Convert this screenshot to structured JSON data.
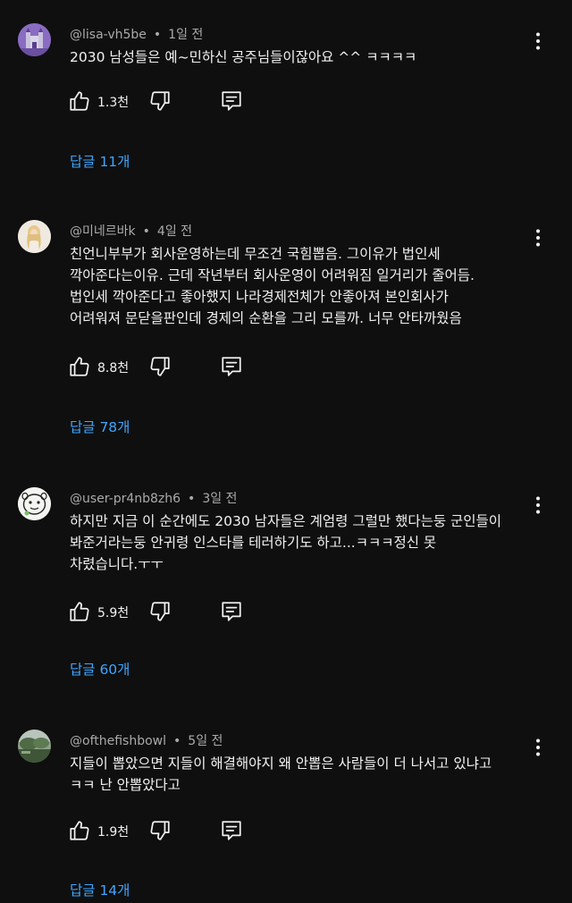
{
  "comments": [
    {
      "author": "@lisa-vh5be",
      "time": "1일 전",
      "lines": [
        "2030 남성들은 예~민하신 공주님들이잖아요 ^^ ㅋㅋㅋㅋ"
      ],
      "likes": "1.3천",
      "replies": "답글 11개",
      "avatar": "avatar-purple-castle"
    },
    {
      "author": "@미네르바k",
      "time": "4일 전",
      "lines": [
        "친언니부부가 회사운영하는데 무조건 국힘뽑음. 그이유가 법인세",
        "깍아준다는이유. 근데 작년부터 회사운영이 어려워짐 일거리가 줄어듬.",
        "법인세 깍아준다고 좋아했지    나라경제전체가 안좋아져 본인회사가",
        "어려워져 문닫을판인데 경제의 순환을 그리 모를까. 너무 안타까웠음"
      ],
      "likes": "8.8천",
      "replies": "답글 78개",
      "avatar": "avatar-blonde-figure"
    },
    {
      "author": "@user-pr4nb8zh6",
      "time": "3일 전",
      "lines": [
        "하지만 지금 이 순간에도 2030 남자들은 계엄령 그럴만 했다는둥 군인들이",
        "봐준거라는둥 안귀령 인스타를 테러하기도 하고...ㅋㅋㅋ정신 못",
        "차렸습니다.ㅜㅜ"
      ],
      "likes": "5.9천",
      "replies": "답글 60개",
      "avatar": "avatar-cartoon-face"
    },
    {
      "author": "@ofthefishbowl",
      "time": "5일 전",
      "lines": [
        "지들이 뽑았으면 지들이 해결해야지 왜 안뽑은 사람들이 더 나서고 있냐고",
        "ㅋㅋ 난 안뽑았다고"
      ],
      "likes": "1.9천",
      "replies": "답글 14개",
      "avatar": "avatar-landscape"
    }
  ],
  "icons": {
    "like": "thumbs-up-icon",
    "dislike": "thumbs-down-icon",
    "reply": "reply-comment-icon",
    "more": "more-vert-icon"
  },
  "colors": {
    "background": "#0f0f0f",
    "text": "#f1f1f1",
    "meta": "#aaaaaa",
    "link": "#3ea6ff"
  }
}
